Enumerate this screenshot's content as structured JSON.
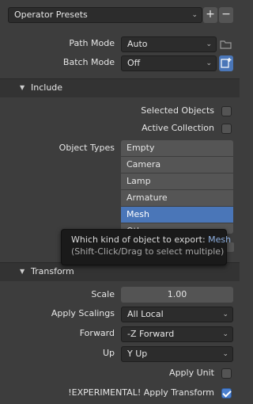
{
  "presets": {
    "label": "Operator Presets",
    "add_label": "+",
    "remove_label": "−"
  },
  "path_mode": {
    "label": "Path Mode",
    "value": "Auto"
  },
  "batch_mode": {
    "label": "Batch Mode",
    "value": "Off"
  },
  "include": {
    "header": "Include",
    "selected_objects": {
      "label": "Selected Objects",
      "checked": false
    },
    "active_collection": {
      "label": "Active Collection",
      "checked": false
    },
    "object_types_label": "Object Types",
    "object_types": [
      "Empty",
      "Camera",
      "Lamp",
      "Armature",
      "Mesh",
      "Other"
    ],
    "selected_type": "Mesh"
  },
  "tooltip": {
    "text": "Which kind of object to export:",
    "value": "Mesh",
    "hint": "(Shift-Click/Drag to select multiple)"
  },
  "transform": {
    "header": "Transform",
    "scale": {
      "label": "Scale",
      "value": "1.00"
    },
    "apply_scalings": {
      "label": "Apply Scalings",
      "value": "All Local"
    },
    "forward": {
      "label": "Forward",
      "value": "-Z Forward"
    },
    "up": {
      "label": "Up",
      "value": "Y Up"
    },
    "apply_unit": {
      "label": "Apply Unit",
      "checked": false
    },
    "apply_transform": {
      "label": "!EXPERIMENTAL! Apply Transform",
      "checked": true
    }
  },
  "icons": {
    "dropdown": "chevron-down-icon",
    "collapse": "triangle-down-icon",
    "path_mode_icon": "folder-icon",
    "batch_icon": "collection-add-icon"
  },
  "colors": {
    "accent": "#4a76b8",
    "background": "#3d3d3d",
    "field": "#2c2c2c"
  }
}
